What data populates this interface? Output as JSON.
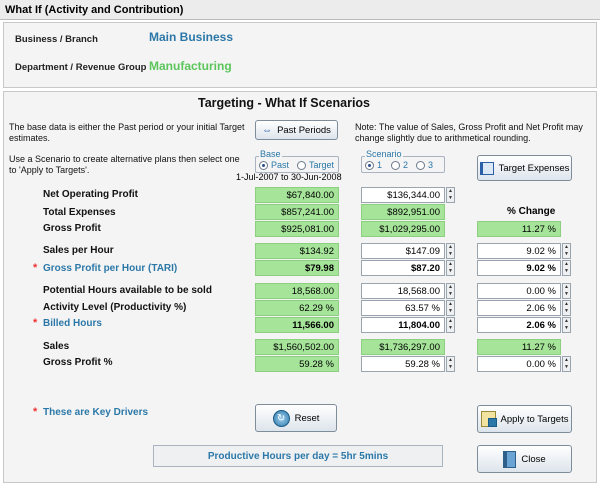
{
  "window": {
    "title": "What If (Activity and Contribution)"
  },
  "header": {
    "business_label": "Business / Branch",
    "business_value": "Main Business",
    "department_label": "Department / Revenue Group",
    "department_value": "Manufacturing"
  },
  "main": {
    "heading": "Targeting - What If Scenarios",
    "intro_text": "The base data is either the Past period or your initial Target estimates.",
    "scenario_text": "Use a Scenario to create alternative plans then select one to 'Apply to Targets'.",
    "note_text": "Note: The value of Sales, Gross Profit and Net Profit may change slightly due to arithmetical rounding.",
    "past_periods_label": "Past Periods",
    "target_expenses_label": "Target Expenses",
    "base_group": {
      "label": "Base",
      "option_past": "Past",
      "option_target": "Target",
      "selected": "Past"
    },
    "date_range": "1-Jul-2007 to 30-Jun-2008",
    "scenario_group": {
      "label": "Scenario",
      "options": [
        "1",
        "2",
        "3"
      ],
      "selected": "1"
    },
    "pct_change_header": "% Change",
    "rows": [
      {
        "label": "Net Operating Profit",
        "base": "$67,840.00",
        "scenario": "$136,344.00",
        "change": ""
      },
      {
        "label": "Total Expenses",
        "base": "$857,241.00",
        "scenario": "$892,951.00",
        "change": ""
      },
      {
        "label": "Gross Profit",
        "base": "$925,081.00",
        "scenario": "$1,029,295.00",
        "change": "11.27 %"
      },
      {
        "label": "Sales per Hour",
        "base": "$134.92",
        "scenario": "$147.09",
        "change": "9.02 %"
      },
      {
        "label": "Gross Profit per Hour (TARI)",
        "base": "$79.98",
        "scenario": "$87.20",
        "change": "9.02 %"
      },
      {
        "label": "Potential Hours available to be sold",
        "base": "18,568.00",
        "scenario": "18,568.00",
        "change": "0.00 %"
      },
      {
        "label": "Activity Level (Productivity %)",
        "base": "62.29 %",
        "scenario": "63.57 %",
        "change": "2.06 %"
      },
      {
        "label": "Billed Hours",
        "base": "11,566.00",
        "scenario": "11,804.00",
        "change": "2.06 %"
      },
      {
        "label": "Sales",
        "base": "$1,560,502.00",
        "scenario": "$1,736,297.00",
        "change": "11.27 %"
      },
      {
        "label": "Gross Profit %",
        "base": "59.28 %",
        "scenario": "59.28 %",
        "change": "0.00 %"
      }
    ],
    "key_drivers_label": "These are Key Drivers",
    "reset_label": "Reset",
    "apply_label": "Apply to Targets",
    "close_label": "Close",
    "productive_hours_text": "Productive Hours per day = 5hr 5mins"
  },
  "colors": {
    "accent_blue": "#2b78a8",
    "accent_green": "#5cc55c",
    "cell_green": "#a6e49a",
    "key_star": "#ee3333"
  }
}
